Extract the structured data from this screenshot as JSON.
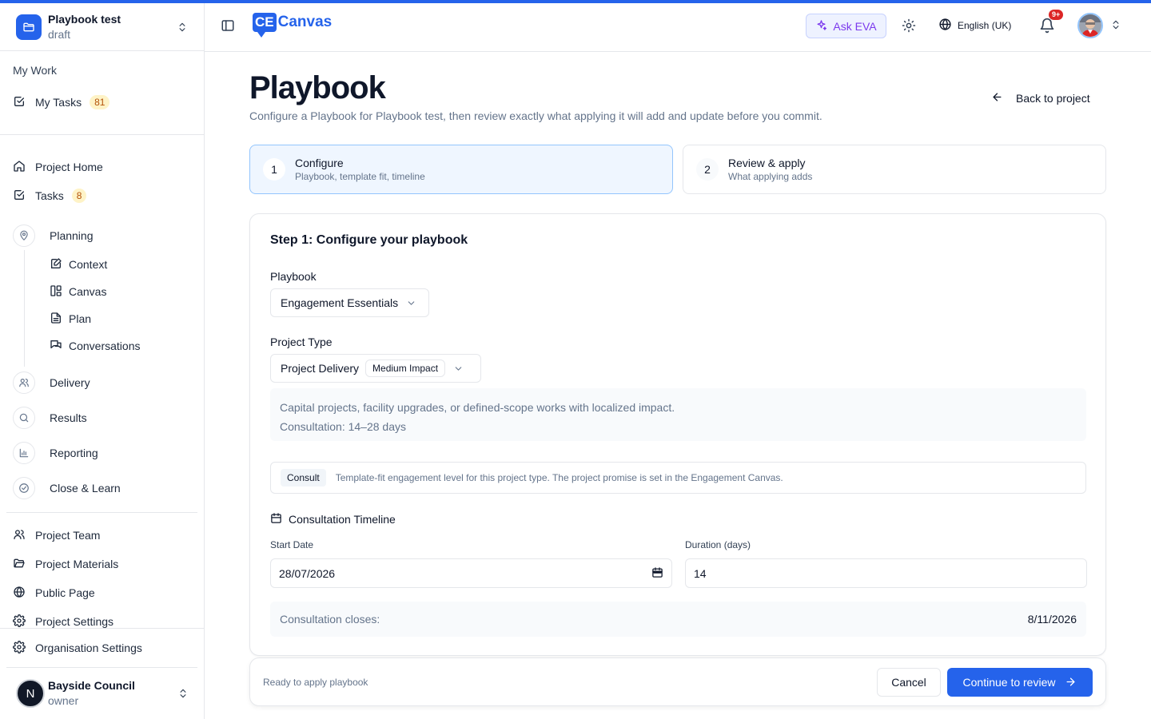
{
  "project": {
    "name": "Playbook test",
    "status": "draft"
  },
  "sidebar": {
    "my_work_label": "My Work",
    "my_tasks": {
      "label": "My Tasks",
      "count": "81"
    },
    "project_home": "Project Home",
    "tasks": {
      "label": "Tasks",
      "count": "8"
    },
    "planning": "Planning",
    "planning_items": [
      "Context",
      "Canvas",
      "Plan",
      "Conversations"
    ],
    "delivery": "Delivery",
    "results": "Results",
    "reporting": "Reporting",
    "close_learn": "Close & Learn",
    "project_team": "Project Team",
    "project_materials": "Project Materials",
    "public_page": "Public Page",
    "project_settings": "Project Settings",
    "organisation_settings": "Organisation Settings",
    "org": {
      "name": "Bayside Council",
      "role": "owner",
      "initial": "N"
    }
  },
  "header": {
    "logo_mark": "CE",
    "logo_word": "Canvas",
    "ask_eva": "Ask EVA",
    "language": "English (UK)",
    "notifications_badge": "9+"
  },
  "page": {
    "title": "Playbook",
    "subtitle": "Configure a Playbook for Playbook test, then review exactly what applying it will add and update before you commit.",
    "back_label": "Back to project"
  },
  "steps": [
    {
      "num": "1",
      "title": "Configure",
      "desc": "Playbook, template fit, timeline",
      "active": true
    },
    {
      "num": "2",
      "title": "Review & apply",
      "desc": "What applying adds",
      "active": false
    }
  ],
  "form": {
    "heading": "Step 1: Configure your playbook",
    "playbook_label": "Playbook",
    "playbook_value": "Engagement Essentials",
    "project_type_label": "Project Type",
    "project_type_value": "Project Delivery",
    "impact_badge": "Medium Impact",
    "type_description": "Capital projects, facility upgrades, or defined-scope works with localized impact.",
    "consultation_range": "Consultation: 14–28 days",
    "engagement_badge": "Consult",
    "engagement_note": "Template-fit engagement level for this project type. The project promise is set in the Engagement Canvas.",
    "timeline_heading": "Consultation Timeline",
    "start_date_label": "Start Date",
    "start_date_value": "28/07/2026",
    "duration_label": "Duration (days)",
    "duration_value": "14",
    "closes_label": "Consultation closes:",
    "closes_value": "8/11/2026"
  },
  "footer": {
    "status": "Ready to apply playbook",
    "cancel": "Cancel",
    "continue": "Continue to review"
  },
  "colors": {
    "accent": "#2563eb",
    "badge_bg": "#fef3c7",
    "badge_text": "#b45309",
    "eva": "#7c3aed",
    "alert": "#dc2626"
  }
}
